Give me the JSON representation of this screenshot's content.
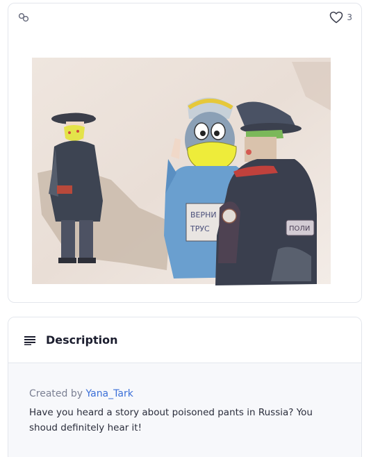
{
  "post": {
    "like_count": "3",
    "artwork_icon": "link-icon",
    "sign_text": [
      "ВЕРНИ",
      "ТРУС"
    ],
    "badge_text": "ПОЛИ"
  },
  "description": {
    "title": "Description",
    "created_prefix": "Created by",
    "author": "Yana_Tark",
    "text": "Have you heard a story about poisoned pants in Russia? You shoud definitely hear it!"
  },
  "colors": {
    "accent": "#3b6fd8",
    "mask": "#e8ec3a",
    "border": "#e3e6ec"
  }
}
